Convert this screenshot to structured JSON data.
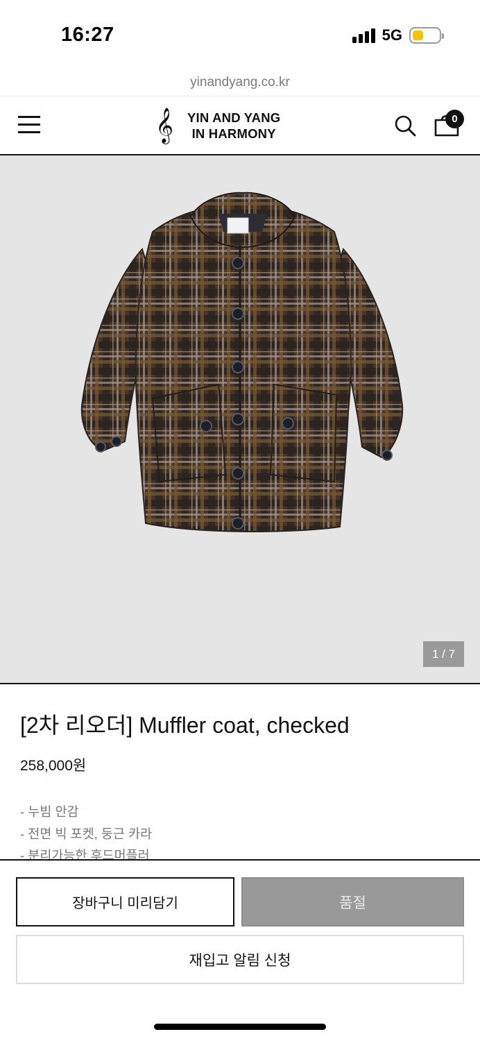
{
  "status_bar": {
    "time": "16:27",
    "network": "5G",
    "battery_level": 0.42,
    "signal_icon": "cellular-signal-icon",
    "battery_icon": "battery-icon"
  },
  "browser": {
    "url": "yinandyang.co.kr"
  },
  "header": {
    "menu_icon": "hamburger-menu-icon",
    "logo_mark": "𝄞",
    "logo_line1": "YIN AND YANG",
    "logo_line2": "IN HARMONY",
    "search_icon": "search-icon",
    "cart_icon": "shopping-bag-icon",
    "cart_count": "0"
  },
  "gallery": {
    "image_subject": "brown plaid muffler coat",
    "counter": "1 / 7"
  },
  "product": {
    "title": "[2차 리오더] Muffler coat, checked",
    "price": "258,000원",
    "description": [
      "- 누빔 안감",
      "- 전면 빅 포켓, 둥근 카라",
      "- 분리가능한 후드머플러"
    ]
  },
  "actions": {
    "add_to_cart_label": "장바구니 미리담기",
    "sold_out_label": "품절",
    "restock_label": "재입고 알림 신청"
  },
  "colors": {
    "accent": "#111111",
    "gallery_bg": "#e6e5e5",
    "sold_out_bg": "#999999",
    "battery": "#f5c400"
  }
}
